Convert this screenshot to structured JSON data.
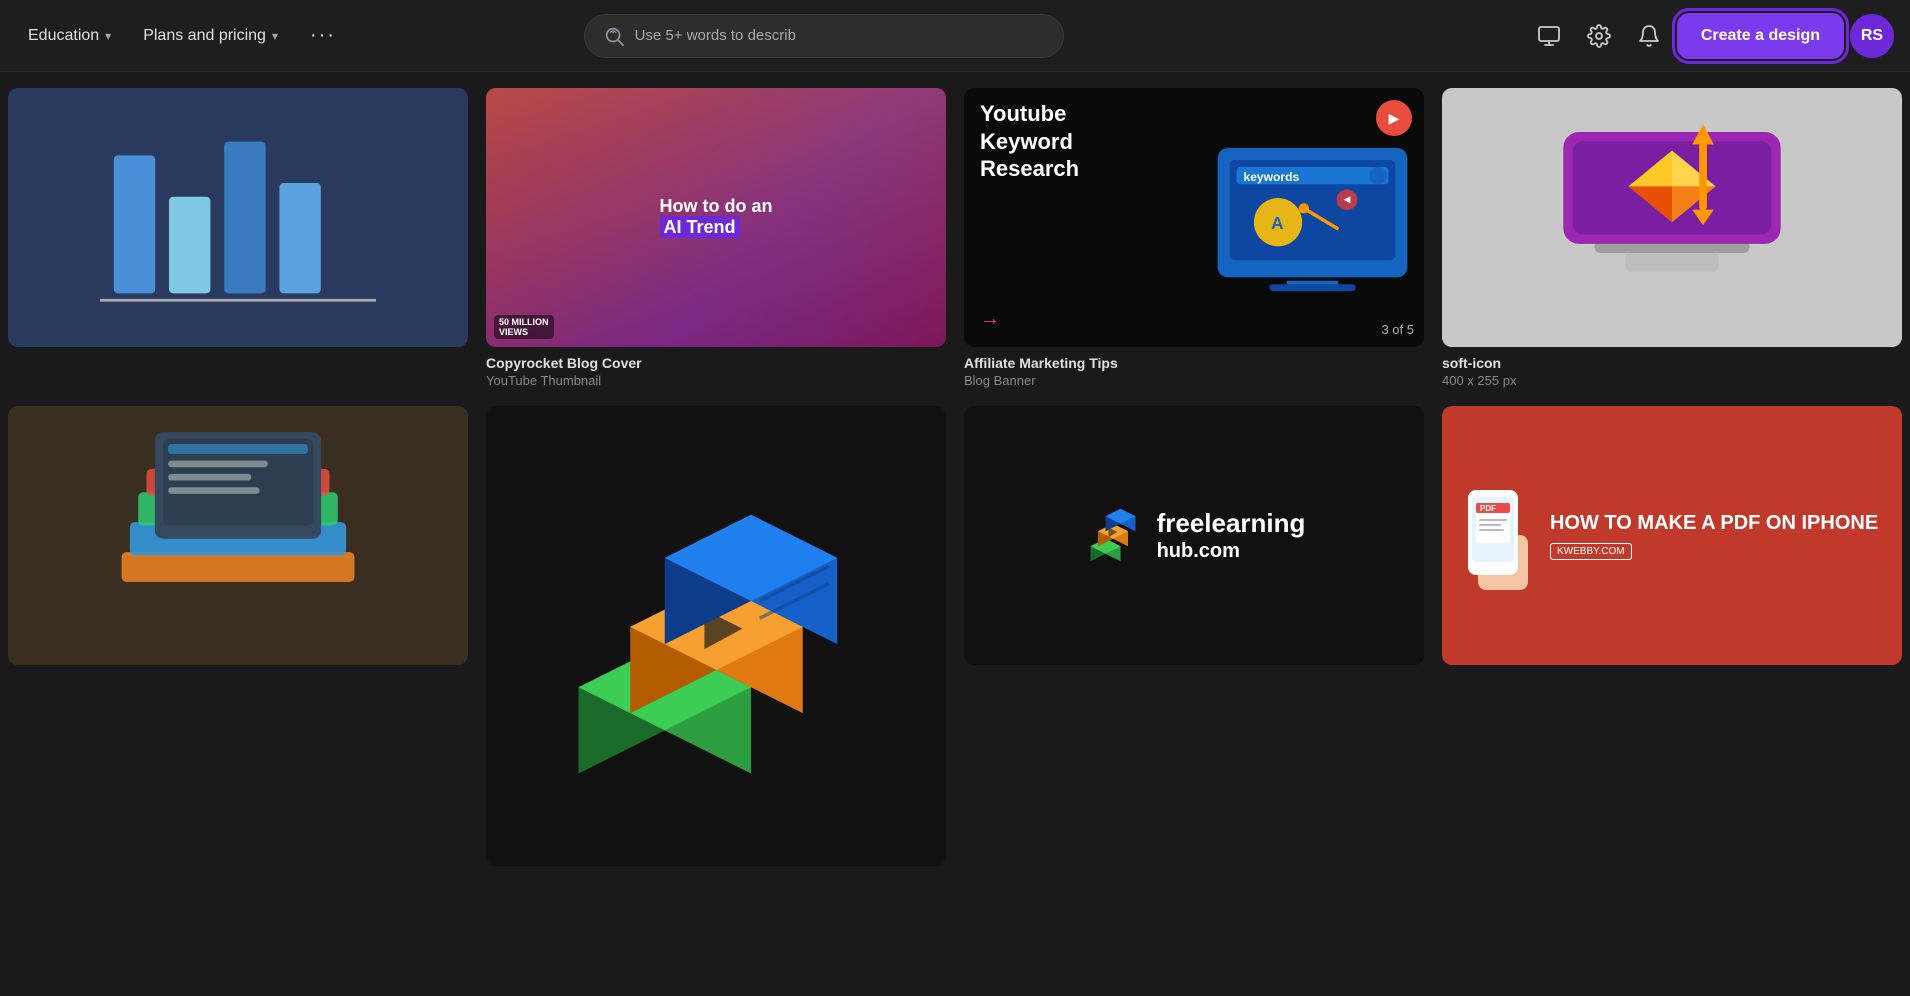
{
  "header": {
    "nav_items": [
      {
        "label": "Education",
        "has_chevron": true
      },
      {
        "label": "Plans and pricing",
        "has_chevron": true
      }
    ],
    "more_label": "···",
    "search_placeholder": "Use 5+ words to describ",
    "create_button_label": "Create a design",
    "avatar_initials": "RS"
  },
  "grid": {
    "row1": [
      {
        "id": "partial-left-1",
        "type": "partial",
        "title": "",
        "subtitle": ""
      },
      {
        "id": "blog-cover",
        "type": "blog-cover",
        "title": "Copyrocket Blog Cover",
        "subtitle": "YouTube Thumbnail",
        "thumb_text_line1": "How to do an",
        "thumb_text_line2": "AI Trend",
        "views": "50 MILLION VIEWS"
      },
      {
        "id": "affiliate",
        "type": "affiliate",
        "title": "Affiliate Marketing Tips",
        "subtitle": "Blog Banner",
        "thumb_title_1": "Youtube",
        "thumb_title_2": "Keyword",
        "thumb_title_3": "Research",
        "counter": "3 of 5"
      },
      {
        "id": "soft-icon",
        "type": "soft-icon",
        "title": "soft-icon",
        "subtitle": "400 x 255 px"
      }
    ],
    "row2": [
      {
        "id": "partial-left-2",
        "type": "partial2",
        "title": "",
        "subtitle": ""
      },
      {
        "id": "box-icon",
        "type": "box-icon",
        "title": "",
        "subtitle": ""
      },
      {
        "id": "freelearning",
        "type": "freelearning",
        "title": "",
        "subtitle": "",
        "text1": "freelearning",
        "text2": "hub.com"
      },
      {
        "id": "pdf-iphone",
        "type": "pdf",
        "title": "",
        "subtitle": "",
        "heading": "HOW TO MAKE A PDF ON IPHONE",
        "site": "KWEBBY.COM"
      }
    ]
  }
}
